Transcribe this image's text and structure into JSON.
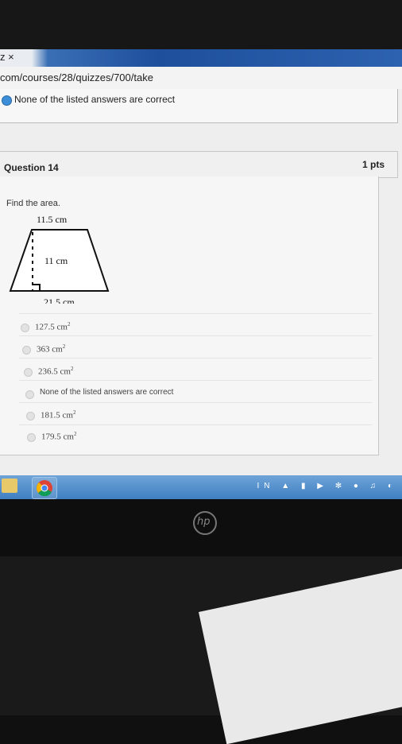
{
  "browser": {
    "tab_close": "z ×",
    "url": "com/courses/28/quizzes/700/take"
  },
  "previous_question": {
    "selected_answer": "None of the listed answers are correct"
  },
  "question": {
    "title": "Question 14",
    "points": "1 pts",
    "prompt": "Find the area.",
    "figure": {
      "top_base": "11.5 cm",
      "height": "11 cm",
      "bottom_base": "21.5 cm"
    },
    "answers": [
      {
        "value": "127.5 cm",
        "sup": "2"
      },
      {
        "value": "363 cm",
        "sup": "2"
      },
      {
        "value": "236.5 cm",
        "sup": "2"
      },
      {
        "value": "None of the listed answers are correct",
        "sup": ""
      },
      {
        "value": "181.5 cm",
        "sup": "2"
      },
      {
        "value": "179.5 cm",
        "sup": "2"
      }
    ]
  },
  "taskbar": {
    "tray_text": "IN"
  },
  "colors": {
    "selected_radio": "#3d8ed8",
    "taskbar": "#4f8ccc"
  }
}
